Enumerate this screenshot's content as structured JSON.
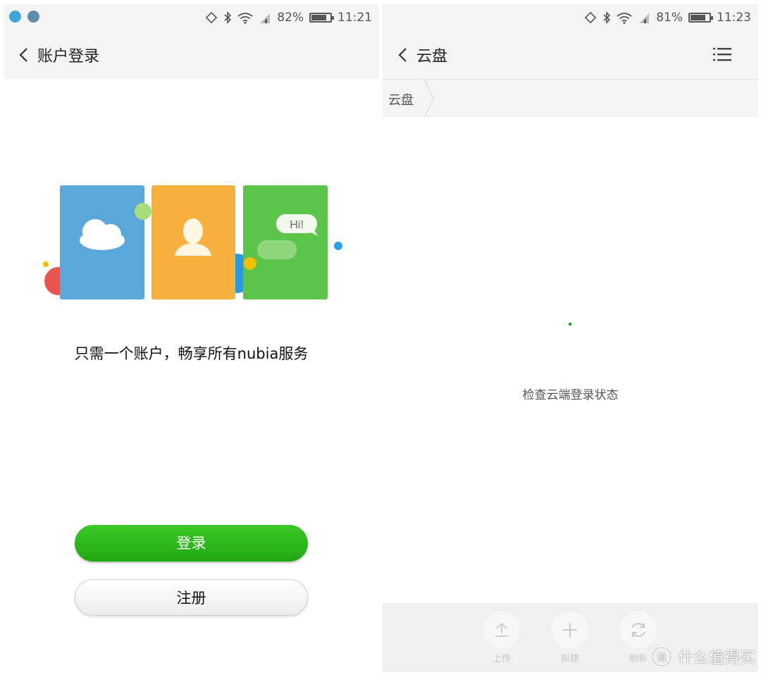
{
  "left": {
    "status": {
      "battery": "82%",
      "time": "11:21",
      "battery_level": 0.82
    },
    "header": {
      "title": "账户登录"
    },
    "illustration": {
      "bubble_text": "Hi!"
    },
    "tagline": "只需一个账户，畅享所有nubia服务",
    "buttons": {
      "login": "登录",
      "register": "注册"
    }
  },
  "right": {
    "status": {
      "battery": "81%",
      "time": "11:23",
      "battery_level": 0.81
    },
    "header": {
      "title": "云盘"
    },
    "breadcrumb": [
      "云盘"
    ],
    "loading_text": "检查云端登录状态",
    "toolbar": {
      "upload": "上传",
      "new": "新建",
      "refresh": "刷新"
    }
  },
  "watermark": {
    "text": "什么值得买",
    "logo_text": "值"
  },
  "colors": {
    "accent_green": "#2db51b",
    "card_blue": "#5aa7dc",
    "card_orange": "#f7b13f",
    "card_green": "#5cc44a"
  },
  "icons": [
    "bluetooth-icon",
    "wifi-icon",
    "signal-icon",
    "battery-icon",
    "back-icon",
    "menu-icon",
    "upload-icon",
    "plus-icon",
    "refresh-icon"
  ]
}
